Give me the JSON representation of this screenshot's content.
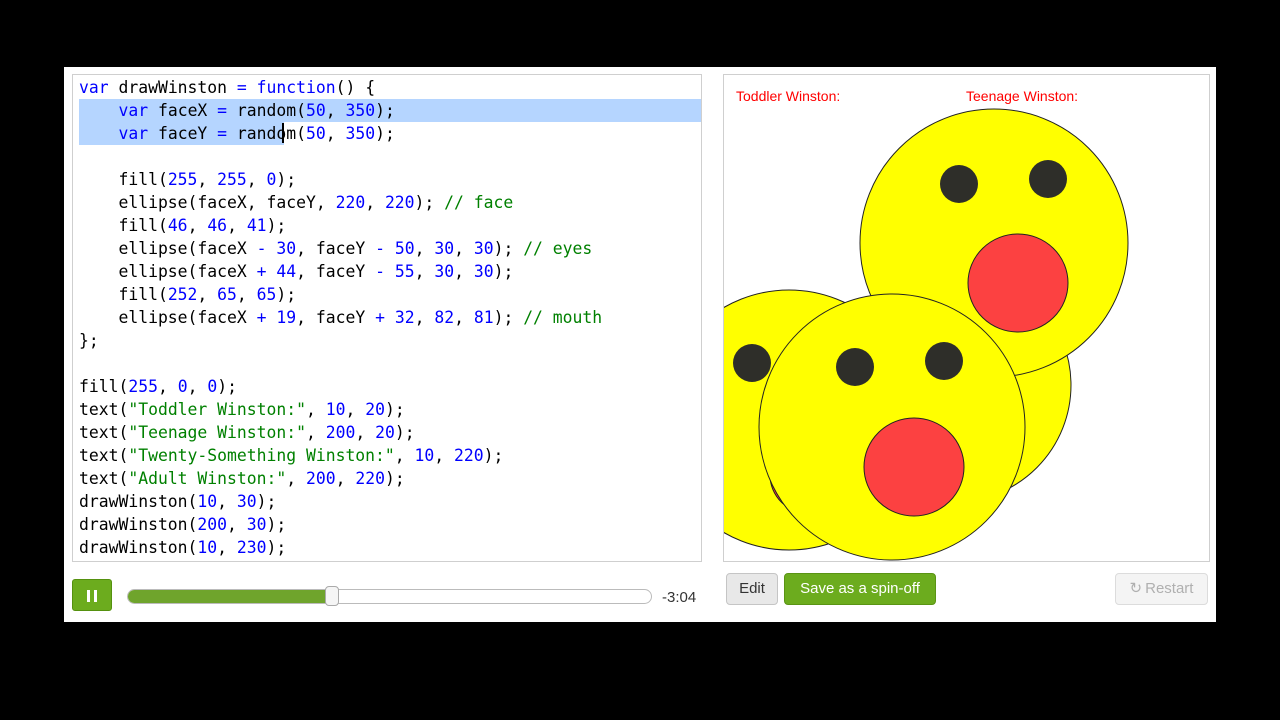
{
  "editor": {
    "lines": [
      [
        [
          "var",
          "kw"
        ],
        [
          " drawWinston ",
          ""
        ],
        [
          "=",
          "op"
        ],
        [
          " ",
          ""
        ],
        [
          "function",
          "kw"
        ],
        [
          "() {",
          ""
        ]
      ],
      [
        [
          "    ",
          ""
        ],
        [
          "var",
          "kw"
        ],
        [
          " faceX ",
          ""
        ],
        [
          "=",
          "op"
        ],
        [
          " random(",
          ""
        ],
        [
          "50",
          "num"
        ],
        [
          ", ",
          ""
        ],
        [
          "350",
          "num"
        ],
        [
          ");",
          ""
        ]
      ],
      [
        [
          "    ",
          ""
        ],
        [
          "var",
          "kw"
        ],
        [
          " faceY ",
          ""
        ],
        [
          "=",
          "op"
        ],
        [
          " random(",
          ""
        ],
        [
          "50",
          "num"
        ],
        [
          ", ",
          ""
        ],
        [
          "350",
          "num"
        ],
        [
          ");",
          ""
        ]
      ],
      [],
      [
        [
          "    fill(",
          ""
        ],
        [
          "255",
          "num"
        ],
        [
          ", ",
          ""
        ],
        [
          "255",
          "num"
        ],
        [
          ", ",
          ""
        ],
        [
          "0",
          "num"
        ],
        [
          ");",
          ""
        ]
      ],
      [
        [
          "    ellipse(faceX, faceY, ",
          ""
        ],
        [
          "220",
          "num"
        ],
        [
          ", ",
          ""
        ],
        [
          "220",
          "num"
        ],
        [
          "); ",
          ""
        ],
        [
          "// face",
          "com"
        ]
      ],
      [
        [
          "    fill(",
          ""
        ],
        [
          "46",
          "num"
        ],
        [
          ", ",
          ""
        ],
        [
          "46",
          "num"
        ],
        [
          ", ",
          ""
        ],
        [
          "41",
          "num"
        ],
        [
          ");",
          ""
        ]
      ],
      [
        [
          "    ellipse(faceX ",
          ""
        ],
        [
          "-",
          "op"
        ],
        [
          " ",
          ""
        ],
        [
          "30",
          "num"
        ],
        [
          ", faceY ",
          ""
        ],
        [
          "-",
          "op"
        ],
        [
          " ",
          ""
        ],
        [
          "50",
          "num"
        ],
        [
          ", ",
          ""
        ],
        [
          "30",
          "num"
        ],
        [
          ", ",
          ""
        ],
        [
          "30",
          "num"
        ],
        [
          "); ",
          ""
        ],
        [
          "// eyes",
          "com"
        ]
      ],
      [
        [
          "    ellipse(faceX ",
          ""
        ],
        [
          "+",
          "op"
        ],
        [
          " ",
          ""
        ],
        [
          "44",
          "num"
        ],
        [
          ", faceY ",
          ""
        ],
        [
          "-",
          "op"
        ],
        [
          " ",
          ""
        ],
        [
          "55",
          "num"
        ],
        [
          ", ",
          ""
        ],
        [
          "30",
          "num"
        ],
        [
          ", ",
          ""
        ],
        [
          "30",
          "num"
        ],
        [
          ");",
          ""
        ]
      ],
      [
        [
          "    fill(",
          ""
        ],
        [
          "252",
          "num"
        ],
        [
          ", ",
          ""
        ],
        [
          "65",
          "num"
        ],
        [
          ", ",
          ""
        ],
        [
          "65",
          "num"
        ],
        [
          ");",
          ""
        ]
      ],
      [
        [
          "    ellipse(faceX ",
          ""
        ],
        [
          "+",
          "op"
        ],
        [
          " ",
          ""
        ],
        [
          "19",
          "num"
        ],
        [
          ", faceY ",
          ""
        ],
        [
          "+",
          "op"
        ],
        [
          " ",
          ""
        ],
        [
          "32",
          "num"
        ],
        [
          ", ",
          ""
        ],
        [
          "82",
          "num"
        ],
        [
          ", ",
          ""
        ],
        [
          "81",
          "num"
        ],
        [
          "); ",
          ""
        ],
        [
          "// mouth",
          "com"
        ]
      ],
      [
        [
          "};",
          ""
        ]
      ],
      [],
      [
        [
          "fill(",
          ""
        ],
        [
          "255",
          "num"
        ],
        [
          ", ",
          ""
        ],
        [
          "0",
          "num"
        ],
        [
          ", ",
          ""
        ],
        [
          "0",
          "num"
        ],
        [
          ");",
          ""
        ]
      ],
      [
        [
          "text(",
          ""
        ],
        [
          "\"Toddler Winston:\"",
          "str"
        ],
        [
          ", ",
          ""
        ],
        [
          "10",
          "num"
        ],
        [
          ", ",
          ""
        ],
        [
          "20",
          "num"
        ],
        [
          ");",
          ""
        ]
      ],
      [
        [
          "text(",
          ""
        ],
        [
          "\"Teenage Winston:\"",
          "str"
        ],
        [
          ", ",
          ""
        ],
        [
          "200",
          "num"
        ],
        [
          ", ",
          ""
        ],
        [
          "20",
          "num"
        ],
        [
          ");",
          ""
        ]
      ],
      [
        [
          "text(",
          ""
        ],
        [
          "\"Twenty-Something Winston:\"",
          "str"
        ],
        [
          ", ",
          ""
        ],
        [
          "10",
          "num"
        ],
        [
          ", ",
          ""
        ],
        [
          "220",
          "num"
        ],
        [
          ");",
          ""
        ]
      ],
      [
        [
          "text(",
          ""
        ],
        [
          "\"Adult Winston:\"",
          "str"
        ],
        [
          ", ",
          ""
        ],
        [
          "200",
          "num"
        ],
        [
          ", ",
          ""
        ],
        [
          "220",
          "num"
        ],
        [
          ");",
          ""
        ]
      ],
      [
        [
          "drawWinston(",
          ""
        ],
        [
          "10",
          "num"
        ],
        [
          ", ",
          ""
        ],
        [
          "30",
          "num"
        ],
        [
          ");",
          ""
        ]
      ],
      [
        [
          "drawWinston(",
          ""
        ],
        [
          "200",
          "num"
        ],
        [
          ", ",
          ""
        ],
        [
          "30",
          "num"
        ],
        [
          ");",
          ""
        ]
      ],
      [
        [
          "drawWinston(",
          ""
        ],
        [
          "10",
          "num"
        ],
        [
          ", ",
          ""
        ],
        [
          "230",
          "num"
        ],
        [
          ");",
          ""
        ]
      ]
    ],
    "selected_lines": [
      1,
      2
    ]
  },
  "canvas": {
    "labels": {
      "toddler": "Toddler Winston:",
      "teenage": "Teenage Winston:"
    },
    "colors": {
      "face": "#ffff00",
      "eyes": "#2e2e29",
      "mouth": "#fc4141",
      "text": "#ff0000"
    }
  },
  "player": {
    "state": "playing",
    "progress": 0.39,
    "time_remaining": "-3:04"
  },
  "buttons": {
    "edit": "Edit",
    "spinoff": "Save as a spin-off",
    "restart": "Restart"
  },
  "colors": {
    "accent_green": "#6cac1e",
    "selection": "#b5d5ff"
  }
}
